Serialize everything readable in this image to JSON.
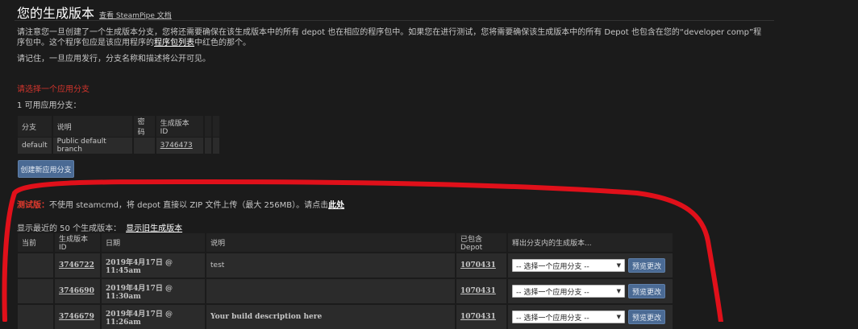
{
  "header": {
    "title": "您的生成版本",
    "docs_link": "查看 SteamPipe 文档"
  },
  "intro": {
    "para1_before": "请注意您一旦创建了一个生成版本分支，您将还需要确保在该生成版本中的所有 depot 也在相应的程序包中。如果您在进行测试，您将需要确保该生成版本中的所有 Depot 也包含在您的“developer comp”程序包中。这个程序包应是该应用程序的",
    "para1_link": "程序包列表",
    "para1_after": "中红色的那个。",
    "para2": "请记住，一旦应用发行，分支名称和描述将公开可见。"
  },
  "branch_section": {
    "warning": "请选择一个应用分支",
    "count_label": "1 可用应用分支：",
    "columns": [
      "分支",
      "说明",
      "密码",
      "生成版本 ID"
    ],
    "rows": [
      {
        "branch": "default",
        "description": "Public default branch",
        "password": "",
        "build_id": "3746473"
      }
    ],
    "create_button": "创建新应用分支"
  },
  "test_notice": {
    "label": "测试版：",
    "text": "不使用 steamcmd，将 depot 直接以 ZIP 文件上传（最大 256MB）。请点击",
    "link": "此处"
  },
  "builds": {
    "recent_label": "显示最近的 50 个生成版本：",
    "show_old_link": "显示旧生成版本",
    "columns": [
      "当前",
      "生成版本 ID",
      "日期",
      "说明",
      "已包含 Depot",
      "释出分支内的生成版本..."
    ],
    "rows": [
      {
        "current": "",
        "build_id": "3746722",
        "date": "2019年4月17日 @ 11:45am",
        "description": "test",
        "depot": "1070431",
        "select": "-- 选择一个应用分支 --",
        "preview": "预览更改"
      },
      {
        "current": "",
        "build_id": "3746690",
        "date": "2019年4月17日 @ 11:30am",
        "description": "",
        "depot": "1070431",
        "select": "-- 选择一个应用分支 --",
        "preview": "预览更改"
      },
      {
        "current": "",
        "build_id": "3746679",
        "date": "2019年4月17日 @ 11:26am",
        "description": "Your build description here",
        "depot": "1070431",
        "select": "-- 选择一个应用分支 --",
        "preview": "预览更改"
      }
    ]
  },
  "annotation": {
    "color": "#e0101a"
  }
}
